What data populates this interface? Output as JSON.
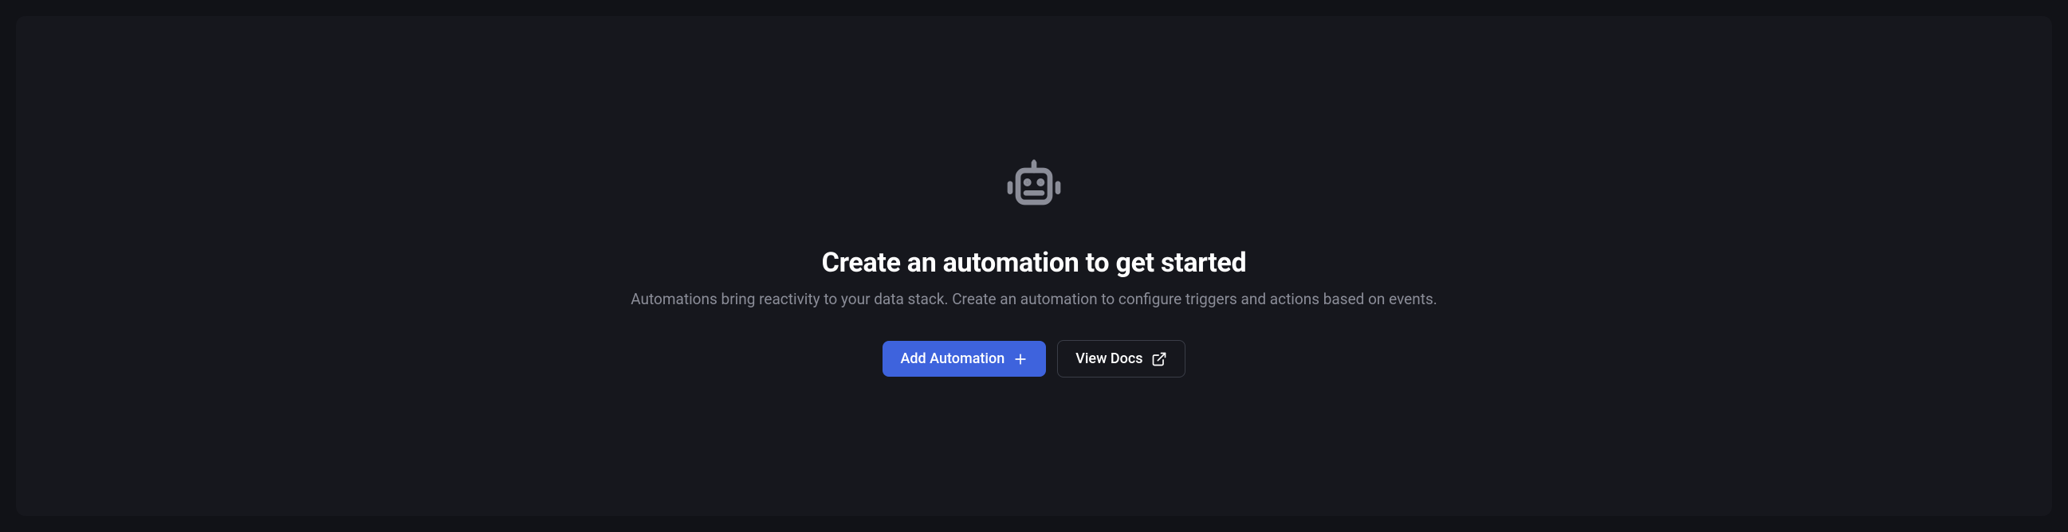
{
  "empty_state": {
    "heading": "Create an automation to get started",
    "description": "Automations bring reactivity to your data stack. Create an automation to configure triggers and actions based on events.",
    "primary_button_label": "Add Automation",
    "secondary_button_label": "View Docs"
  }
}
